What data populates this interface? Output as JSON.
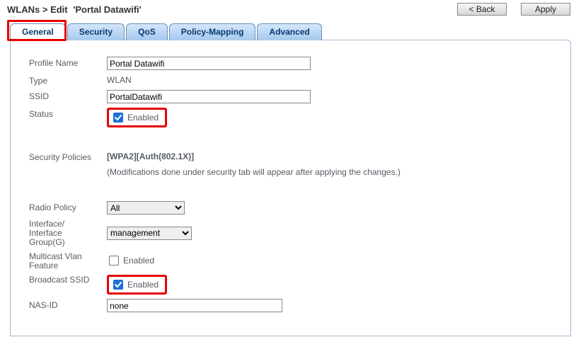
{
  "header": {
    "crumb1": "WLANs",
    "sep": ">",
    "crumb2": "Edit",
    "name": "'Portal Datawifi'",
    "back": "< Back",
    "apply": "Apply"
  },
  "tabs": {
    "general": "General",
    "security": "Security",
    "qos": "QoS",
    "policy": "Policy-Mapping",
    "advanced": "Advanced"
  },
  "labels": {
    "profile_name": "Profile Name",
    "type": "Type",
    "ssid": "SSID",
    "status": "Status",
    "security_policies": "Security Policies",
    "radio_policy": "Radio Policy",
    "interface": "Interface/ Interface Group(G)",
    "multicast": "Multicast Vlan Feature",
    "broadcast": "Broadcast SSID",
    "nasid": "NAS-ID",
    "enabled": "Enabled"
  },
  "values": {
    "profile_name": "Portal Datawifi",
    "type": "WLAN",
    "ssid": "PortalDatawifi",
    "status_checked": true,
    "security_policy": "[WPA2][Auth(802.1X)]",
    "security_note": "(Modifications done under security tab will appear after applying the changes.)",
    "radio_policy_selected": "All",
    "interface_selected": "management",
    "multicast_checked": false,
    "broadcast_checked": true,
    "nasid": "none"
  }
}
